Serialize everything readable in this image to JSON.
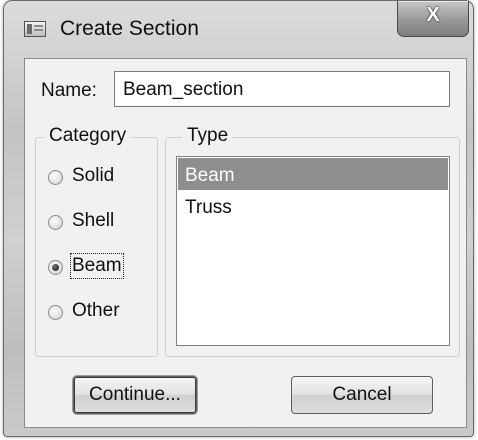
{
  "window": {
    "title": "Create Section"
  },
  "name": {
    "label": "Name:",
    "value": "Beam_section"
  },
  "category": {
    "legend": "Category",
    "options": [
      "Solid",
      "Shell",
      "Beam",
      "Other"
    ],
    "selected": "Beam"
  },
  "type": {
    "legend": "Type",
    "items": [
      "Beam",
      "Truss"
    ],
    "selected": "Beam"
  },
  "buttons": {
    "continue": "Continue...",
    "cancel": "Cancel"
  },
  "icons": {
    "app": "section-dialog-icon",
    "close": "close-icon",
    "close_glyph": "X"
  }
}
